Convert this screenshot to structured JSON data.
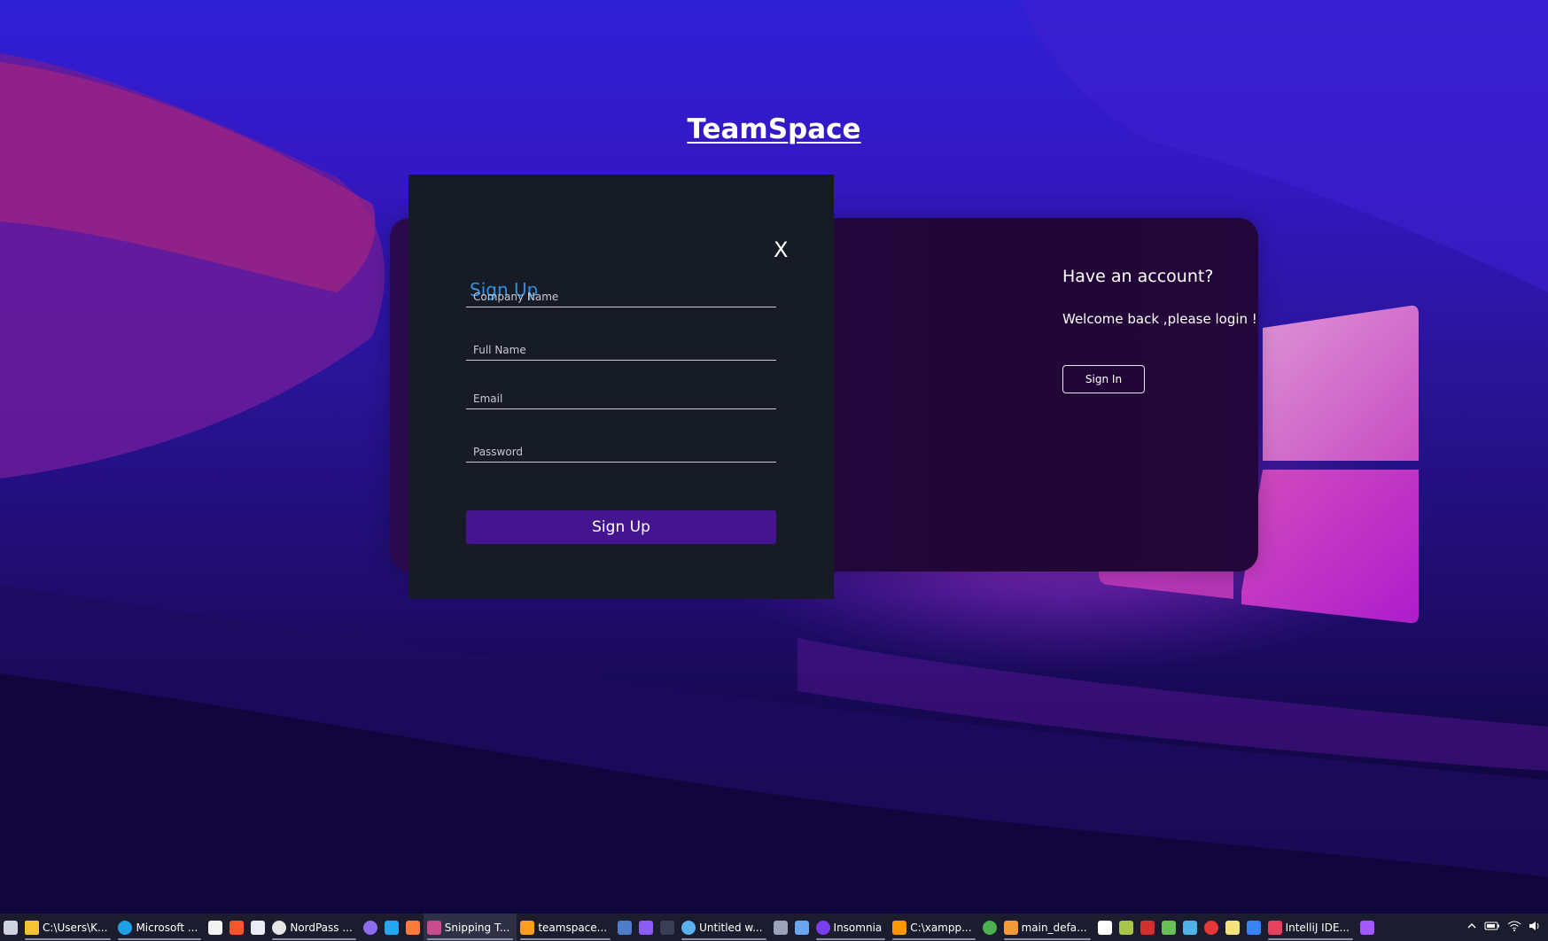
{
  "app": {
    "title": "TeamSpace"
  },
  "signin_panel": {
    "heading": "Have an account?",
    "subtext": "Welcome back ,please login !",
    "button_label": "Sign In"
  },
  "signup_form": {
    "close_label": "X",
    "title": "Sign Up",
    "fields": [
      {
        "placeholder": "Company Name",
        "value": ""
      },
      {
        "placeholder": "Full Name",
        "value": ""
      },
      {
        "placeholder": "Email",
        "value": ""
      },
      {
        "placeholder": "Password",
        "value": ""
      }
    ],
    "submit_label": "Sign Up"
  },
  "taskbar": {
    "items": [
      {
        "icon": "start-icon",
        "label": "",
        "color": "#cfd3e0"
      },
      {
        "icon": "folder-icon",
        "label": "C:\\Users\\K...",
        "color": "#f4c430"
      },
      {
        "icon": "edge-icon",
        "label": "Microsoft ...",
        "color": "#1fa0e6"
      },
      {
        "icon": "calendar-icon",
        "label": "",
        "color": "#f2f2f2"
      },
      {
        "icon": "brave-icon",
        "label": "",
        "color": "#fb542b"
      },
      {
        "icon": "document-icon",
        "label": "",
        "color": "#e8ecf7"
      },
      {
        "icon": "nordpass-icon",
        "label": "NordPass ...",
        "color": "#e6e6e6"
      },
      {
        "icon": "github-icon",
        "label": "",
        "color": "#8e6cf0"
      },
      {
        "icon": "vscode-icon",
        "label": "",
        "color": "#23a7f2"
      },
      {
        "icon": "app-icon",
        "label": "",
        "color": "#ff7a3c"
      },
      {
        "icon": "snipping-tool-icon",
        "label": "Snipping T...",
        "color": "#c94c8c"
      },
      {
        "icon": "search-app-icon",
        "label": "teamspace...",
        "color": "#ff9f1a"
      },
      {
        "icon": "app-icon",
        "label": "",
        "color": "#4f7cc9"
      },
      {
        "icon": "app-icon",
        "label": "",
        "color": "#8b5cf6"
      },
      {
        "icon": "terminal-icon",
        "label": "",
        "color": "#3a3f55"
      },
      {
        "icon": "browser-icon",
        "label": "Untitled w...",
        "color": "#5ab1f0"
      },
      {
        "icon": "calculator-icon",
        "label": "",
        "color": "#9aa3b8"
      },
      {
        "icon": "photos-icon",
        "label": "",
        "color": "#6aa7f0"
      },
      {
        "icon": "insomnia-icon",
        "label": "Insomnia",
        "color": "#7a3df0"
      },
      {
        "icon": "sublime-icon",
        "label": "C:\\xampp...",
        "color": "#ff9800"
      },
      {
        "icon": "chrome-icon",
        "label": "",
        "color": "#4caf50"
      },
      {
        "icon": "app-icon",
        "label": "main_defa...",
        "color": "#f29b38"
      },
      {
        "icon": "app-icon",
        "label": "",
        "color": "#ffffff"
      },
      {
        "icon": "app-icon",
        "label": "",
        "color": "#a8c64a"
      },
      {
        "icon": "filezilla-icon",
        "label": "",
        "color": "#d32f2f"
      },
      {
        "icon": "app-icon",
        "label": "",
        "color": "#6bbf59"
      },
      {
        "icon": "cloud-icon",
        "label": "",
        "color": "#4fb3e8"
      },
      {
        "icon": "opera-icon",
        "label": "",
        "color": "#e53935"
      },
      {
        "icon": "notes-icon",
        "label": "",
        "color": "#f4e27a"
      },
      {
        "icon": "calendar-icon",
        "label": "",
        "color": "#3b82f6"
      },
      {
        "icon": "intellij-icon",
        "label": "IntelliJ IDE...",
        "color": "#e8415f"
      },
      {
        "icon": "app-icon",
        "label": "",
        "color": "#a259ff"
      }
    ],
    "tray_icons": [
      "chevron-up-icon",
      "battery-icon",
      "wifi-icon",
      "volume-icon"
    ]
  }
}
